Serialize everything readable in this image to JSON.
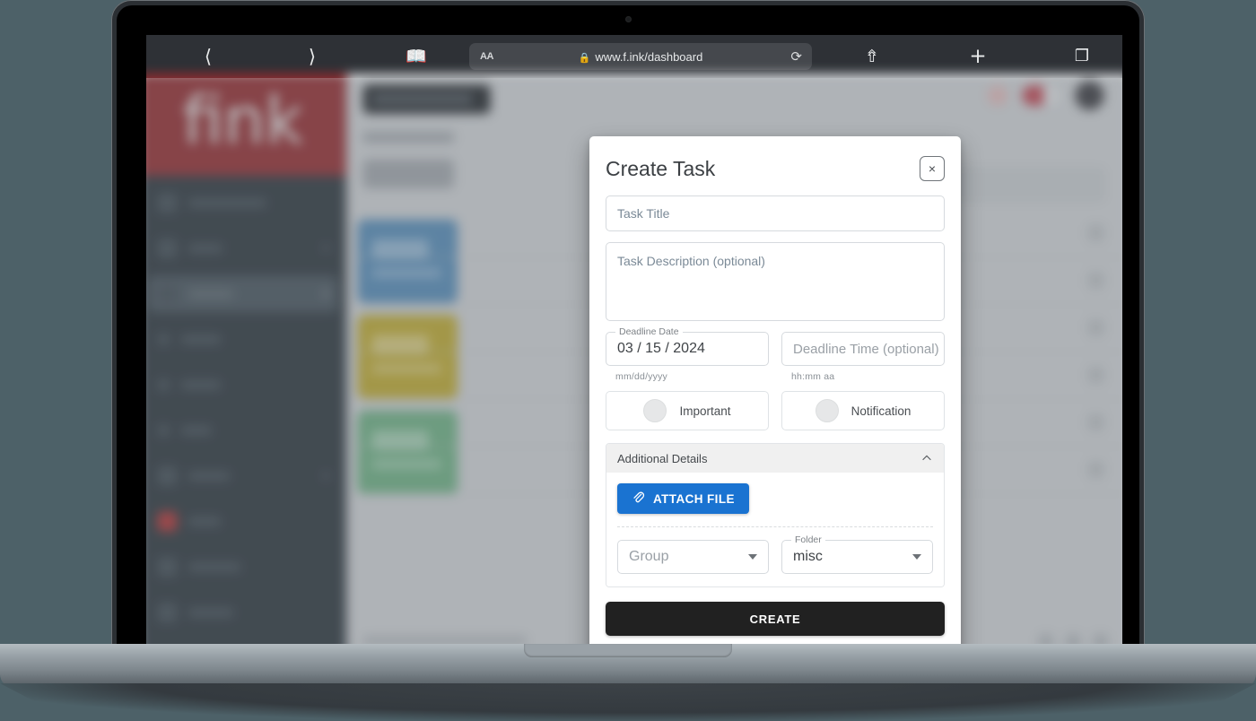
{
  "browser": {
    "back_icon": "chevron-left",
    "forward_icon": "chevron-right",
    "bookmarks_icon": "book",
    "text_size_label": "AA",
    "lock_icon": "🔒",
    "url": "www.f.ink/dashboard",
    "reload_icon": "↻",
    "share_icon": "share",
    "new_tab_label": "+",
    "tabs_icon": "tabs"
  },
  "sidebar": {
    "logo": "fink",
    "items": [
      {
        "label": "Dashboard",
        "icon": "grid-icon",
        "active": false,
        "expandable": false
      },
      {
        "label": "Tasks",
        "icon": "checklist-icon",
        "active": false,
        "expandable": true
      },
      {
        "label": "Groups",
        "icon": "people-icon",
        "active": true,
        "expandable": true
      },
      {
        "label": "Family",
        "icon": "dot-icon",
        "active": false,
        "expandable": false
      },
      {
        "label": "School",
        "icon": "dot-icon",
        "active": false,
        "expandable": false
      },
      {
        "label": "Work",
        "icon": "dot-icon",
        "active": false,
        "expandable": false
      },
      {
        "label": "Folders",
        "icon": "folder-icon",
        "active": false,
        "expandable": true
      },
      {
        "label": "Inbox",
        "icon": "inbox-icon",
        "active": false,
        "expandable": false
      },
      {
        "label": "Calendar",
        "icon": "calendar-icon",
        "active": false,
        "expandable": false
      },
      {
        "label": "Settings",
        "icon": "gear-icon",
        "active": false,
        "expandable": false
      }
    ]
  },
  "dashboard": {
    "create_task_button": "CREATE TASK",
    "page_title": "Dashboard",
    "filter_pill": "Filter",
    "cards": [
      {
        "value": "180h",
        "sub": "Hours This Week",
        "color": "#5286b0"
      },
      {
        "value": "170h",
        "sub": "Hours Logged",
        "color": "#b7a32f"
      },
      {
        "value": "29th",
        "sub": "Deadline Date",
        "color": "#69a97e"
      }
    ],
    "search_placeholder": "Search",
    "bell_icon": "bell-icon",
    "theme_toggle": "dark-mode-toggle",
    "avatar": "user-avatar",
    "footer": "© 2024 Fink. All Rights Reserved.",
    "footer_link": "Feedback"
  },
  "modal": {
    "title": "Create Task",
    "close_icon": "×",
    "task_title_placeholder": "Task Title",
    "task_title_value": "",
    "task_description_placeholder": "Task Description (optional)",
    "task_description_value": "",
    "deadline_date": {
      "label": "Deadline Date",
      "value": "03 / 15 / 2024",
      "helper": "mm/dd/yyyy"
    },
    "deadline_time": {
      "label": "Deadline Time (optional)",
      "placeholder": "Deadline Time (optional)",
      "value": "",
      "helper": "hh:mm aa"
    },
    "toggles": [
      {
        "label": "Important",
        "state": "off"
      },
      {
        "label": "Notification",
        "state": "off"
      }
    ],
    "details": {
      "header": "Additional Details",
      "collapse_icon": "chevron-up",
      "expanded": true,
      "attach_label": "ATTACH FILE",
      "attach_icon": "paperclip-icon",
      "attach_color": "#1a73d1",
      "group_select": {
        "label": "",
        "placeholder": "Group",
        "value": ""
      },
      "folder_select": {
        "label": "Folder",
        "placeholder": "",
        "value": "misc"
      }
    },
    "submit_label": "CREATE",
    "submit_color": "#212121"
  }
}
